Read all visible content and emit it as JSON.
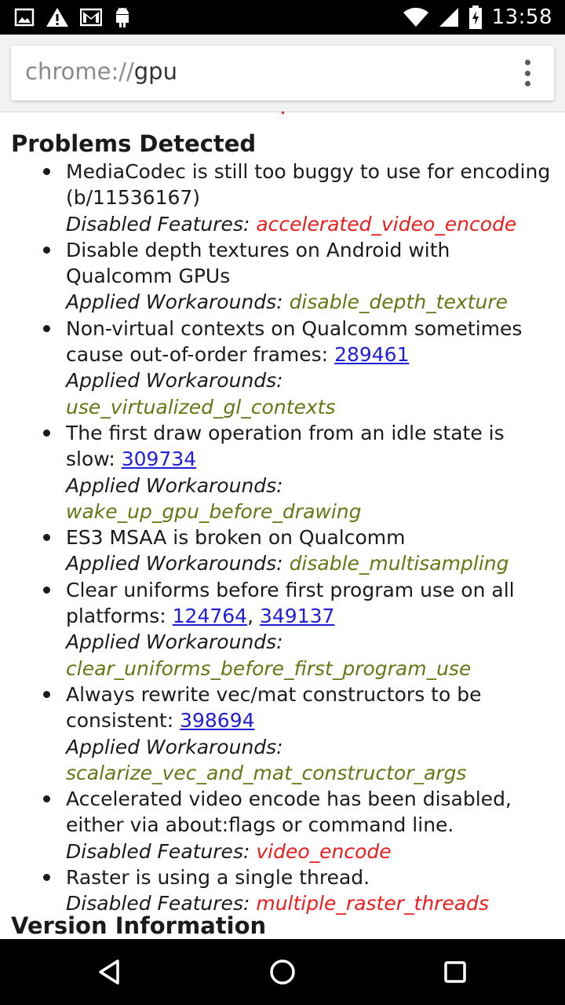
{
  "status_bar": {
    "time": "13:58",
    "icons": [
      "image-icon",
      "warning-icon",
      "gmail-icon",
      "android-icon",
      "wifi-icon",
      "signal-icon",
      "battery-charging-icon"
    ]
  },
  "toolbar": {
    "url_scheme": "chrome://",
    "url_host": "gpu"
  },
  "content": {
    "problems_title": "Problems Detected",
    "version_title": "Version Information",
    "problems": [
      {
        "text": "MediaCodec is still too buggy to use for encoding (b/11536167)",
        "links": [],
        "detail_label": "Disabled Features:",
        "detail_value": "accelerated_video_encode",
        "kind": "disabled"
      },
      {
        "text": "Disable depth textures on Android with Qualcomm GPUs",
        "links": [],
        "detail_label": "Applied Workarounds:",
        "detail_value": "disable_depth_texture",
        "kind": "workaround"
      },
      {
        "text": "Non-virtual contexts on Qualcomm sometimes cause out-of-order frames:",
        "links": [
          "289461"
        ],
        "detail_label": "Applied Workarounds:",
        "detail_value": "use_virtualized_gl_contexts",
        "kind": "workaround"
      },
      {
        "text": "The first draw operation from an idle state is slow:",
        "links": [
          "309734"
        ],
        "detail_label": "Applied Workarounds:",
        "detail_value": "wake_up_gpu_before_drawing",
        "kind": "workaround",
        "break_detail": true
      },
      {
        "text": "ES3 MSAA is broken on Qualcomm",
        "links": [],
        "detail_label": "Applied Workarounds:",
        "detail_value": "disable_multisampling",
        "kind": "workaround"
      },
      {
        "text": "Clear uniforms before first program use on all platforms:",
        "links": [
          "124764",
          "349137"
        ],
        "detail_label": "Applied Workarounds:",
        "detail_value": "clear_uniforms_before_first_program_use",
        "kind": "workaround",
        "break_detail": true
      },
      {
        "text": "Always rewrite vec/mat constructors to be consistent:",
        "links": [
          "398694"
        ],
        "detail_label": "Applied Workarounds:",
        "detail_value": "scalarize_vec_and_mat_constructor_args",
        "kind": "workaround",
        "break_detail": true
      },
      {
        "text": "Accelerated video encode has been disabled, either via about:flags or command line.",
        "links": [],
        "detail_label": "Disabled Features:",
        "detail_value": "video_encode",
        "kind": "disabled"
      },
      {
        "text": "Raster is using a single thread.",
        "links": [],
        "detail_label": "Disabled Features:",
        "detail_value": "multiple_raster_threads",
        "kind": "disabled"
      }
    ]
  },
  "colors": {
    "disabled_feature": "#ee1c1c",
    "workaround": "#6b7414",
    "link": "#1f1fd8"
  },
  "nav_bar": {
    "buttons": [
      "back-icon",
      "home-icon",
      "recents-icon"
    ]
  }
}
